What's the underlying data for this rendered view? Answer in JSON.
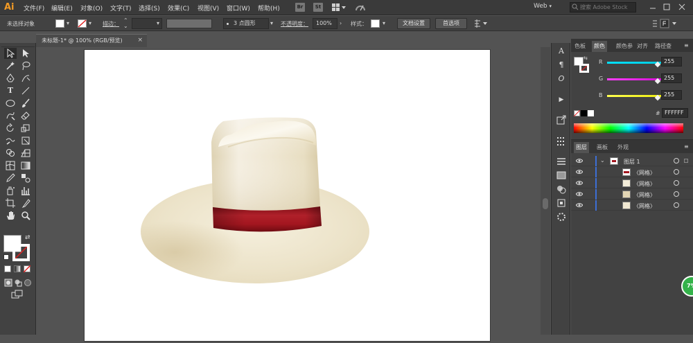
{
  "app": {
    "logo": "Ai"
  },
  "menu": [
    "文件(F)",
    "编辑(E)",
    "对象(O)",
    "文字(T)",
    "选择(S)",
    "效果(C)",
    "视图(V)",
    "窗口(W)",
    "帮助(H)"
  ],
  "chips": [
    "Br",
    "St"
  ],
  "workspace_switcher": "Web",
  "search": {
    "placeholder": "搜索 Adobe Stock"
  },
  "control": {
    "selection_label": "未选择对象",
    "stroke_label": "描边：",
    "brush": "3 点圆形",
    "opacity_label": "不透明度：",
    "opacity_value": "100%",
    "style_label": "样式：",
    "doc_setup": "文档设置",
    "preferences": "首选项"
  },
  "document_tab": {
    "title": "未标题-1* @ 100% (RGB/预览)",
    "close": "×"
  },
  "color_panel": {
    "tabs": [
      "色板",
      "颜色",
      "颜色参",
      "对齐",
      "路径查"
    ],
    "active_tab": 1,
    "channels": [
      {
        "label": "R",
        "value": "255",
        "color": "#00c8d8"
      },
      {
        "label": "G",
        "value": "255",
        "color": "#c800c8"
      },
      {
        "label": "B",
        "value": "255",
        "color": "#e8e800"
      }
    ],
    "hex_label": "#",
    "hex_value": "FFFFFF"
  },
  "layers_panel": {
    "tabs": [
      "图层",
      "画板",
      "外观"
    ],
    "active_tab": 0,
    "layer": {
      "name": "图层 1"
    },
    "items": [
      "〈网格〉",
      "〈网格〉",
      "〈网格〉",
      "〈网格〉"
    ]
  },
  "badge": {
    "text": "7%"
  },
  "colors": {
    "accent_orange": "#f29a25",
    "hat_band": "#a3161f",
    "hat_body": "#ece3cb",
    "layer_blue": "#3d6fd6",
    "badge_green": "#34b24a"
  }
}
